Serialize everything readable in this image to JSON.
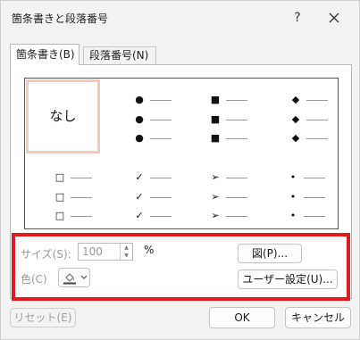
{
  "window": {
    "title": "箇条書きと段落番号",
    "help_label": "?"
  },
  "tabs": [
    {
      "label": "箇条書き(B)"
    },
    {
      "label": "段落番号(N)"
    }
  ],
  "gallery": {
    "none_label": "なし",
    "bullets_row1": [
      "●",
      "■",
      "◆"
    ],
    "bullets_row2": [
      "□",
      "✓",
      "➢",
      "•"
    ]
  },
  "size": {
    "label": "サイズ(S):",
    "value": "100",
    "unit": "%"
  },
  "color": {
    "label": "色(C)"
  },
  "buttons": {
    "picture": "図(P)...",
    "custom": "ユーザー設定(U)...",
    "reset": "リセット(E)",
    "ok": "OK",
    "cancel": "キャンセル"
  },
  "colors": {
    "highlight_border": "#e8171b",
    "selected_cell": "#f2cbb8"
  }
}
